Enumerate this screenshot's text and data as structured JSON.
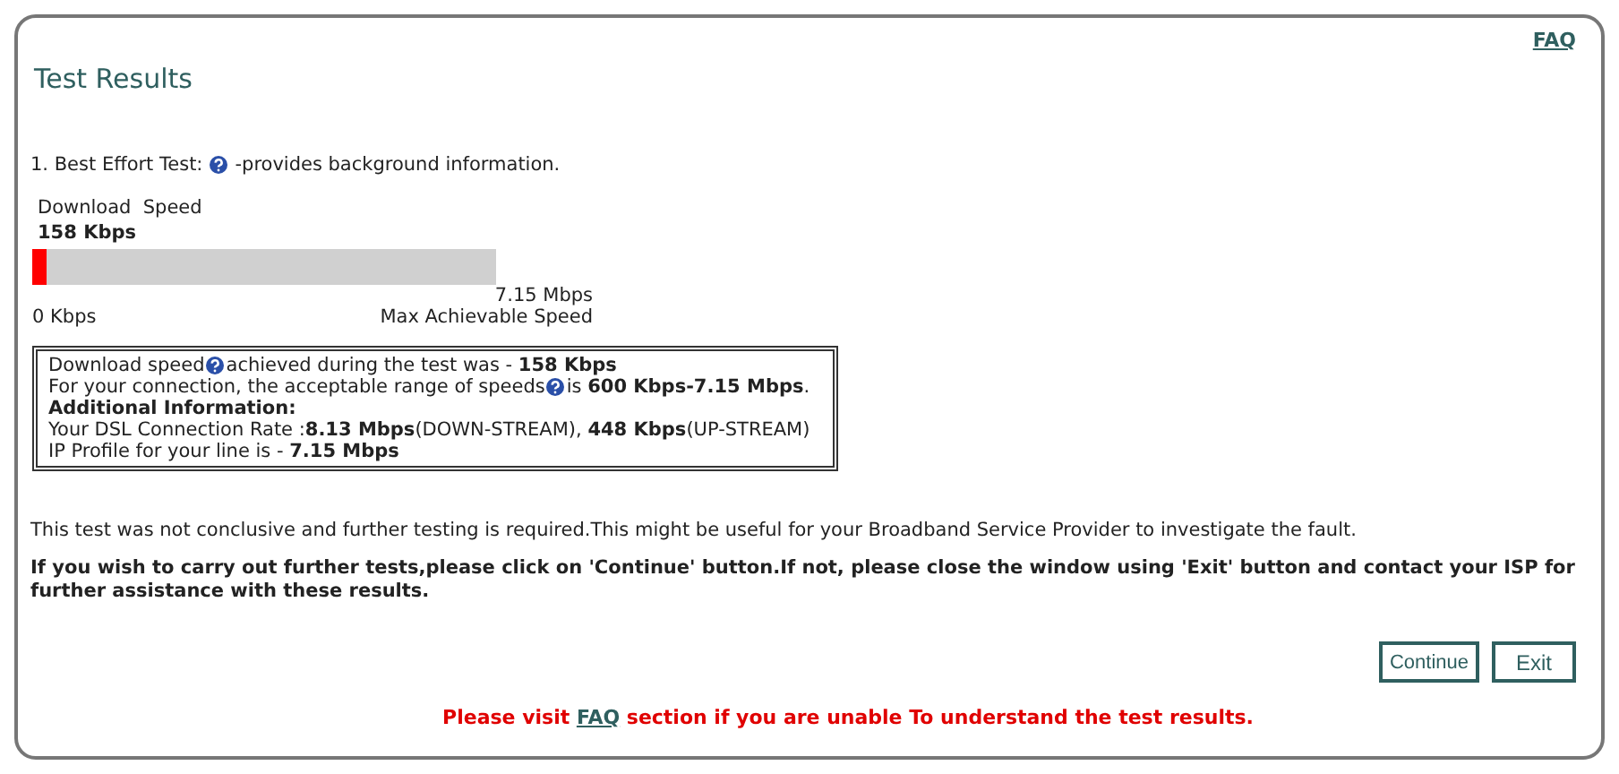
{
  "faq_link": "FAQ",
  "title": "Test Results",
  "test_heading": {
    "before": "1. Best Effort Test:",
    "after": "-provides background information."
  },
  "speed_meter": {
    "label": "Download  Speed",
    "value": "158 Kbps",
    "level": 0.03,
    "min_label": "0 Kbps",
    "max_label": "7.15 Mbps",
    "max_caption": "Max Achievable Speed"
  },
  "info_box": [
    {
      "parts": [
        "Download speed",
        "achieved during the test was - **158 Kbps**"
      ]
    },
    {
      "parts": [
        "For your connection, the acceptable range of speeds",
        " is **600 Kbps-7.15 Mbps**."
      ]
    },
    {
      "parts": [
        "**Additional Information:**"
      ]
    },
    {
      "parts": [
        "Your DSL Connection Rate :**8.13 Mbps**(DOWN-STREAM), **448 Kbps**(UP-STREAM)"
      ]
    },
    {
      "parts": [
        "IP Profile for your line is - **7.15 Mbps**"
      ]
    }
  ],
  "conclusion": "This test was not conclusive and further testing is required.This might be useful for your Broadband Service Provider to investigate the fault.",
  "instruction": "If you wish to carry out further tests,please click on 'Continue' button.If not, please close the window using 'Exit' button and contact your ISP for further assistance with these results.",
  "buttons": [
    "Continue",
    "Exit"
  ],
  "footer": {
    "before": "Please visit ",
    "link": "FAQ",
    "after": " section if you are unable To understand the test results."
  }
}
